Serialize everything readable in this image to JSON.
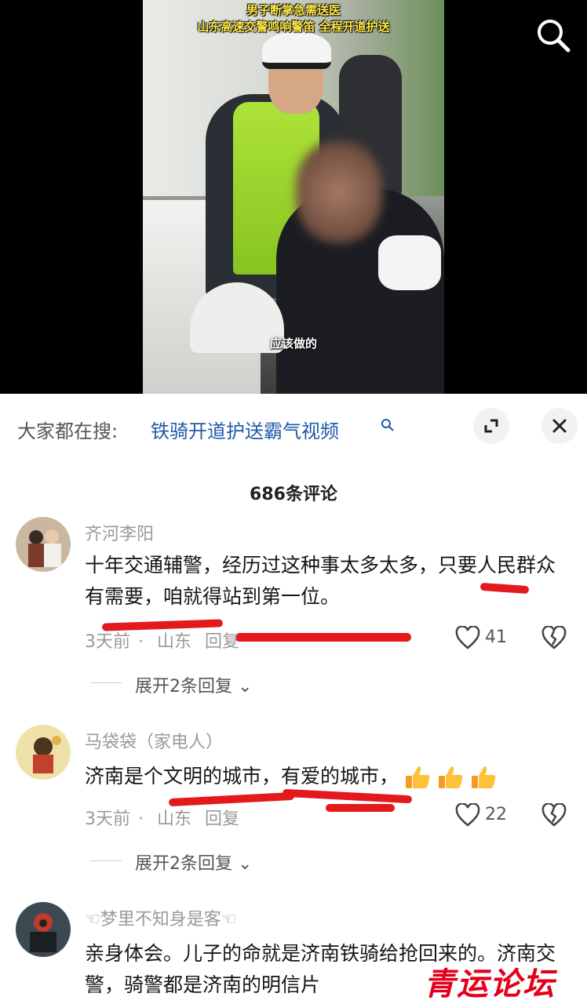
{
  "video": {
    "title_line1": "男子断掌急需送医",
    "title_line2": "山东高速交警鸣响警笛  全程开道护送",
    "subtitle": "应该做的"
  },
  "search_bar": {
    "prefix": "大家都在搜:",
    "query": "铁骑开道护送霸气视频"
  },
  "comment_count": "686条评论",
  "comments": [
    {
      "author": "齐河李阳",
      "text": "十年交通辅警，经历过这种事太多太多，只要人民群众有需要，咱就得站到第一位。",
      "time": "3天前",
      "location": "山东",
      "reply_label": "回复",
      "likes": "41",
      "expand": "展开2条回复"
    },
    {
      "author": "马袋袋（家电人）",
      "text": "济南是个文明的城市，有爱的城市，",
      "time": "3天前",
      "location": "山东",
      "reply_label": "回复",
      "likes": "22",
      "expand": "展开2条回复"
    },
    {
      "author": "☜梦里不知身是客☜",
      "text": "亲身体会。儿子的命就是济南铁骑给抢回来的。济南交警，骑警都是济南的明信片"
    }
  ],
  "watermark": "青运论坛",
  "colors": {
    "title_yellow": "#ffe94a",
    "link_blue": "#1e5aa8",
    "annotation_red": "#e3191c"
  }
}
